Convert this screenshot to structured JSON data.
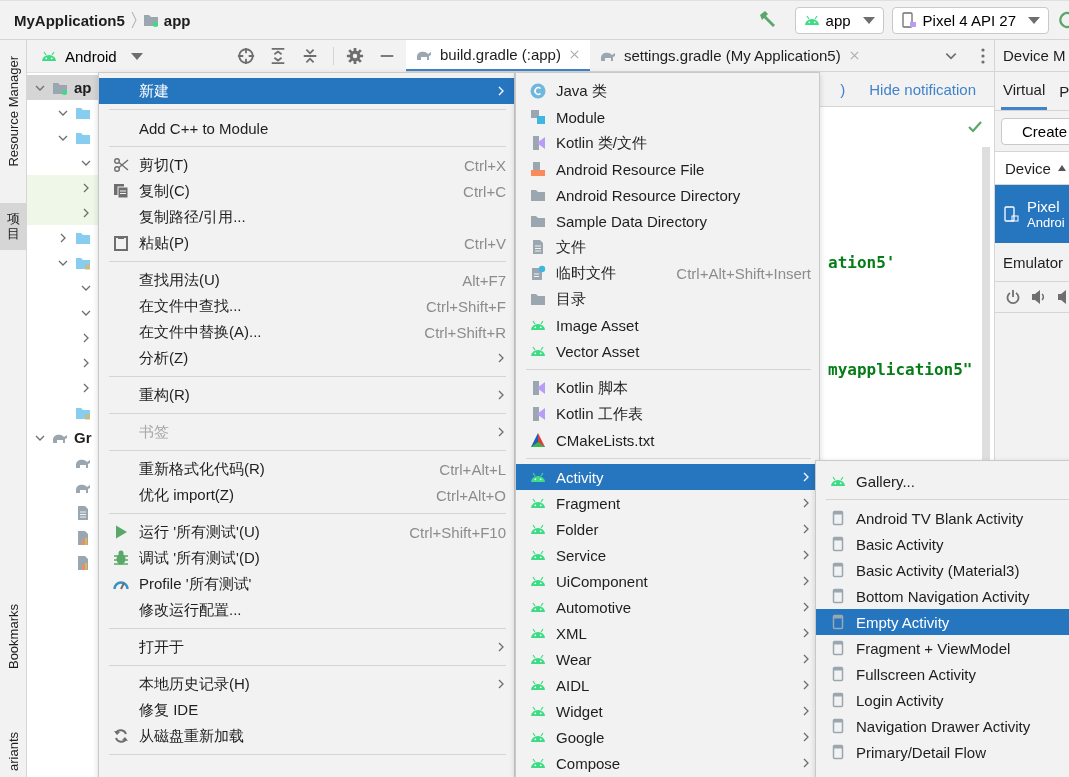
{
  "breadcrumb": [
    {
      "label": "MyApplication5"
    },
    {
      "label": "app"
    }
  ],
  "toolbar": {
    "config": "app",
    "device": "Pixel 4 API 27"
  },
  "side_tabs": [
    {
      "label": "Resource Manager",
      "selected": false,
      "kind": "latin"
    },
    {
      "label": "项目",
      "selected": true,
      "kind": "cjk"
    },
    {
      "label": "Bookmarks",
      "selected": false,
      "kind": "latin"
    },
    {
      "label": "ariants",
      "selected": false,
      "kind": "latin"
    }
  ],
  "project_panel": {
    "view": "Android",
    "tree": [
      {
        "label": "ap",
        "expanded": true,
        "highlighted": false,
        "selected": true,
        "children": [
          {
            "expanded": true,
            "highlighted": false,
            "selected": false
          },
          {
            "expanded": true,
            "highlighted": false,
            "selected": false,
            "children": [
              {
                "expanded": true,
                "highlighted": false,
                "selected": false
              },
              {
                "expanded": false,
                "highlighted": true,
                "selected": false
              },
              {
                "expanded": false,
                "highlighted": true,
                "selected": false
              }
            ]
          },
          {
            "expanded": false,
            "highlighted": false,
            "selected": false
          },
          {
            "expanded": true,
            "highlighted": false,
            "selected": false,
            "children": [
              {
                "expanded": true,
                "highlighted": false,
                "selected": false
              },
              {
                "expanded": true,
                "highlighted": false,
                "selected": false
              },
              {
                "expanded": false,
                "highlighted": false,
                "selected": false
              },
              {
                "expanded": false,
                "highlighted": false,
                "selected": false
              },
              {
                "expanded": false,
                "highlighted": false,
                "selected": false
              }
            ]
          },
          {
            "highlighted": false,
            "selected": false
          }
        ]
      },
      {
        "label": "Gr",
        "expanded": true,
        "highlighted": false,
        "selected": false,
        "children": [
          {
            "highlighted": false,
            "selected": false
          },
          {
            "highlighted": false,
            "selected": false
          },
          {
            "highlighted": false,
            "selected": false
          },
          {
            "highlighted": false,
            "selected": false
          },
          {
            "highlighted": false,
            "selected": false
          }
        ]
      }
    ]
  },
  "editor_tabs": [
    {
      "label": "build.gradle (:app)",
      "selected": true
    },
    {
      "label": "settings.gradle (My Application5)",
      "selected": false
    }
  ],
  "notification": {
    "text": ")",
    "action": "Hide notification"
  },
  "code_lines": [
    {
      "text": "ation5'"
    },
    {
      "text": "myapplication5\""
    }
  ],
  "device_manager": {
    "title": "Device M",
    "tabs": [
      {
        "label": "Virtual",
        "selected": true
      },
      {
        "label": "P",
        "selected": false
      }
    ],
    "create_button": "Create",
    "column": "Device",
    "devices": [
      {
        "name": "Pixel",
        "detail": "Androi",
        "selected": true
      }
    ],
    "emulator_label": "Emulator"
  },
  "context_menu": [
    {
      "kind": "item",
      "label": "新建",
      "submenu": true,
      "selected": true,
      "disabled": false
    },
    {
      "kind": "separator"
    },
    {
      "kind": "item",
      "label": "Add C++ to Module",
      "submenu": false,
      "selected": false,
      "disabled": false
    },
    {
      "kind": "separator"
    },
    {
      "kind": "item",
      "label": "剪切(T)",
      "shortcut": "Ctrl+X",
      "submenu": false,
      "selected": false,
      "disabled": false
    },
    {
      "kind": "item",
      "label": "复制(C)",
      "shortcut": "Ctrl+C",
      "submenu": false,
      "selected": false,
      "disabled": false
    },
    {
      "kind": "item",
      "label": "复制路径/引用...",
      "submenu": false,
      "selected": false,
      "disabled": false
    },
    {
      "kind": "item",
      "label": "粘贴(P)",
      "shortcut": "Ctrl+V",
      "submenu": false,
      "selected": false,
      "disabled": false
    },
    {
      "kind": "separator"
    },
    {
      "kind": "item",
      "label": "查找用法(U)",
      "shortcut": "Alt+F7",
      "submenu": false,
      "selected": false,
      "disabled": false
    },
    {
      "kind": "item",
      "label": "在文件中查找...",
      "shortcut": "Ctrl+Shift+F",
      "submenu": false,
      "selected": false,
      "disabled": false
    },
    {
      "kind": "item",
      "label": "在文件中替换(A)...",
      "shortcut": "Ctrl+Shift+R",
      "submenu": false,
      "selected": false,
      "disabled": false
    },
    {
      "kind": "item",
      "label": "分析(Z)",
      "submenu": true,
      "selected": false,
      "disabled": false
    },
    {
      "kind": "separator"
    },
    {
      "kind": "item",
      "label": "重构(R)",
      "submenu": true,
      "selected": false,
      "disabled": false
    },
    {
      "kind": "separator"
    },
    {
      "kind": "item",
      "label": "书签",
      "submenu": true,
      "selected": false,
      "disabled": true
    },
    {
      "kind": "separator"
    },
    {
      "kind": "item",
      "label": "重新格式化代码(R)",
      "shortcut": "Ctrl+Alt+L",
      "submenu": false,
      "selected": false,
      "disabled": false
    },
    {
      "kind": "item",
      "label": "优化 import(Z)",
      "shortcut": "Ctrl+Alt+O",
      "submenu": false,
      "selected": false,
      "disabled": false
    },
    {
      "kind": "separator"
    },
    {
      "kind": "item",
      "label": "运行 '所有测试'(U)",
      "shortcut": "Ctrl+Shift+F10",
      "submenu": false,
      "selected": false,
      "disabled": false
    },
    {
      "kind": "item",
      "label": "调试 '所有测试'(D)",
      "submenu": false,
      "selected": false,
      "disabled": false
    },
    {
      "kind": "item",
      "label": "Profile '所有测试'",
      "submenu": false,
      "selected": false,
      "disabled": false
    },
    {
      "kind": "item",
      "label": "修改运行配置...",
      "submenu": false,
      "selected": false,
      "disabled": false
    },
    {
      "kind": "separator"
    },
    {
      "kind": "item",
      "label": "打开于",
      "submenu": true,
      "selected": false,
      "disabled": false
    },
    {
      "kind": "separator"
    },
    {
      "kind": "item",
      "label": "本地历史记录(H)",
      "submenu": true,
      "selected": false,
      "disabled": false
    },
    {
      "kind": "item",
      "label": "修复 IDE",
      "submenu": false,
      "selected": false,
      "disabled": false
    },
    {
      "kind": "item",
      "label": "从磁盘重新加载",
      "submenu": false,
      "selected": false,
      "disabled": false
    },
    {
      "kind": "separator"
    }
  ],
  "new_menu": [
    {
      "kind": "item",
      "label": "Java 类",
      "submenu": false,
      "selected": false
    },
    {
      "kind": "item",
      "label": "Module",
      "submenu": false,
      "selected": false
    },
    {
      "kind": "item",
      "label": "Kotlin 类/文件",
      "submenu": false,
      "selected": false
    },
    {
      "kind": "item",
      "label": "Android Resource File",
      "submenu": false,
      "selected": false
    },
    {
      "kind": "item",
      "label": "Android Resource Directory",
      "submenu": false,
      "selected": false
    },
    {
      "kind": "item",
      "label": "Sample Data Directory",
      "submenu": false,
      "selected": false
    },
    {
      "kind": "item",
      "label": "文件",
      "submenu": false,
      "selected": false
    },
    {
      "kind": "item",
      "label": "临时文件",
      "shortcut": "Ctrl+Alt+Shift+Insert",
      "submenu": false,
      "selected": false
    },
    {
      "kind": "item",
      "label": "目录",
      "submenu": false,
      "selected": false
    },
    {
      "kind": "item",
      "label": "Image Asset",
      "submenu": false,
      "selected": false
    },
    {
      "kind": "item",
      "label": "Vector Asset",
      "submenu": false,
      "selected": false
    },
    {
      "kind": "separator"
    },
    {
      "kind": "item",
      "label": "Kotlin 脚本",
      "submenu": false,
      "selected": false
    },
    {
      "kind": "item",
      "label": "Kotlin 工作表",
      "submenu": false,
      "selected": false
    },
    {
      "kind": "item",
      "label": "CMakeLists.txt",
      "submenu": false,
      "selected": false
    },
    {
      "kind": "separator"
    },
    {
      "kind": "item",
      "label": "Activity",
      "submenu": true,
      "selected": true
    },
    {
      "kind": "item",
      "label": "Fragment",
      "submenu": true,
      "selected": false
    },
    {
      "kind": "item",
      "label": "Folder",
      "submenu": true,
      "selected": false
    },
    {
      "kind": "item",
      "label": "Service",
      "submenu": true,
      "selected": false
    },
    {
      "kind": "item",
      "label": "UiComponent",
      "submenu": true,
      "selected": false
    },
    {
      "kind": "item",
      "label": "Automotive",
      "submenu": true,
      "selected": false
    },
    {
      "kind": "item",
      "label": "XML",
      "submenu": true,
      "selected": false
    },
    {
      "kind": "item",
      "label": "Wear",
      "submenu": true,
      "selected": false
    },
    {
      "kind": "item",
      "label": "AIDL",
      "submenu": true,
      "selected": false
    },
    {
      "kind": "item",
      "label": "Widget",
      "submenu": true,
      "selected": false
    },
    {
      "kind": "item",
      "label": "Google",
      "submenu": true,
      "selected": false
    },
    {
      "kind": "item",
      "label": "Compose",
      "submenu": true,
      "selected": false
    }
  ],
  "activity_menu": [
    {
      "kind": "item",
      "label": "Gallery...",
      "submenu": false,
      "selected": false
    },
    {
      "kind": "separator"
    },
    {
      "kind": "item",
      "label": "Android TV Blank Activity",
      "submenu": false,
      "selected": false
    },
    {
      "kind": "item",
      "label": "Basic Activity",
      "submenu": false,
      "selected": false
    },
    {
      "kind": "item",
      "label": "Basic Activity (Material3)",
      "submenu": false,
      "selected": false
    },
    {
      "kind": "item",
      "label": "Bottom Navigation Activity",
      "submenu": false,
      "selected": false
    },
    {
      "kind": "item",
      "label": "Empty Activity",
      "submenu": false,
      "selected": true
    },
    {
      "kind": "item",
      "label": "Fragment + ViewModel",
      "submenu": false,
      "selected": false
    },
    {
      "kind": "item",
      "label": "Fullscreen Activity",
      "submenu": false,
      "selected": false
    },
    {
      "kind": "item",
      "label": "Login Activity",
      "submenu": false,
      "selected": false
    },
    {
      "kind": "item",
      "label": "Navigation Drawer Activity",
      "submenu": false,
      "selected": false
    },
    {
      "kind": "item",
      "label": "Primary/Detail Flow",
      "submenu": false,
      "selected": false
    }
  ]
}
